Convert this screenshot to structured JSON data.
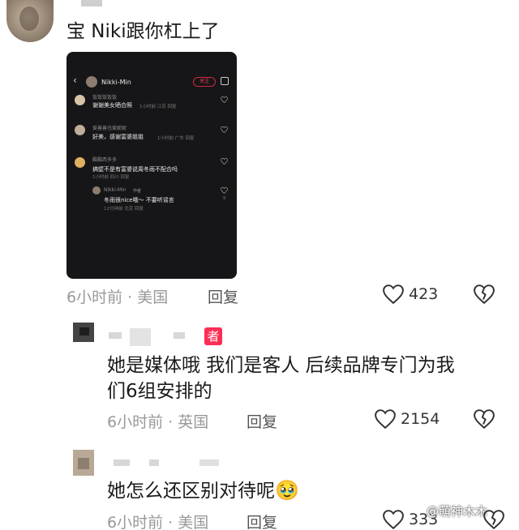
{
  "comments": [
    {
      "text": "宝 Niki跟你杠上了",
      "time": "6小时前",
      "location": "美国",
      "reply_label": "回复",
      "likes": "423",
      "embedded_screenshot": {
        "username": "Nikki-Min",
        "follow_label": "关注",
        "comments": [
          {
            "user": "饭饭饭饭饭",
            "text": "谢谢美女晒合照",
            "meta": "1小时前 江苏 回复"
          },
          {
            "user": "爱善善也爱妮妮",
            "text": "好美，感谢富婆姐姐",
            "meta": "1小时前 广东 回复"
          },
          {
            "user": "酷酷西多多",
            "text": "搞壁不是有富婆说周冬雨不配合吗",
            "meta": "1小时前 四川 回复"
          },
          {
            "user": "Nikki-Min",
            "author_tag": "作者",
            "text": "冬雨很nice哦～ 不要听谣言",
            "meta": "12分钟前 北京 回复",
            "likes": "9"
          }
        ]
      }
    },
    {
      "text_line1": "她是媒体哦 我们是客人 后续品牌专门为我",
      "text_line2": "们6组安排的",
      "author_badge": "者",
      "time": "6小时前",
      "location": "英国",
      "reply_label": "回复",
      "likes": "2154"
    },
    {
      "text": "她怎么还区别对待呢",
      "emoji": "🥹",
      "time": "6小时前",
      "location": "美国",
      "reply_label": "回复",
      "likes": "333",
      "watermark": "@萌神木木"
    }
  ],
  "colors": {
    "accent": "#ff2d55",
    "meta": "#999999",
    "dark_bg": "#161618"
  },
  "icons": [
    "heart-icon",
    "broken-heart-icon",
    "back-icon",
    "share-icon"
  ]
}
